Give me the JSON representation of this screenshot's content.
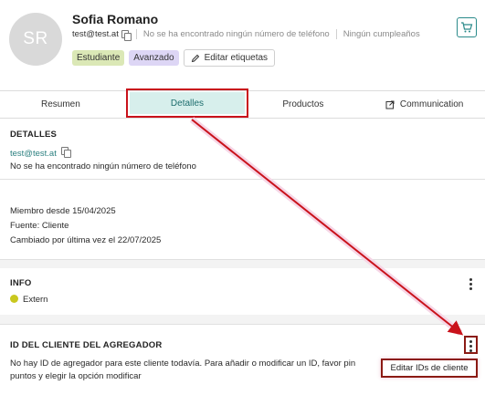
{
  "contact": {
    "initials": "SR",
    "name": "Sofia Romano",
    "email": "test@test.at",
    "phone_status": "No se ha encontrado ningún número de teléfono",
    "birthday_status": "Ningún cumpleaños"
  },
  "tags": {
    "items": [
      "Estudiante",
      "Avanzado"
    ],
    "edit_label": "Editar etiquetas"
  },
  "tabs": [
    {
      "label": "Resumen"
    },
    {
      "label": "Detalles"
    },
    {
      "label": "Productos"
    },
    {
      "label": "Communication"
    }
  ],
  "details": {
    "heading": "DETALLES",
    "email": "test@test.at",
    "phone": "No se ha encontrado ningún número de teléfono",
    "member_since": "Miembro desde 15/04/2025",
    "source": "Fuente: Cliente",
    "changed": "Cambiado por última vez el 22/07/2025"
  },
  "info": {
    "heading": "INFO",
    "status": "Extern"
  },
  "aggregator": {
    "heading": "ID DEL CLIENTE DEL AGREGADOR",
    "line1": "No hay ID de agregador para este cliente todavía. Para añadir o modificar un ID, favor pin",
    "line2": "puntos y elegir la opción modificar",
    "menu_item": "Editar IDs de cliente"
  },
  "colors": {
    "accent": "#2a7f7f",
    "highlight_red": "#c9121b",
    "highlight_dark": "#8b1a14",
    "tag_green": "#dbe8b6",
    "tag_purple": "#ddd6f5",
    "status_yellow": "#c9c81e"
  },
  "icons": [
    "copy-icon",
    "pencil-icon",
    "cart-icon",
    "external-link-icon",
    "kebab-icon"
  ]
}
